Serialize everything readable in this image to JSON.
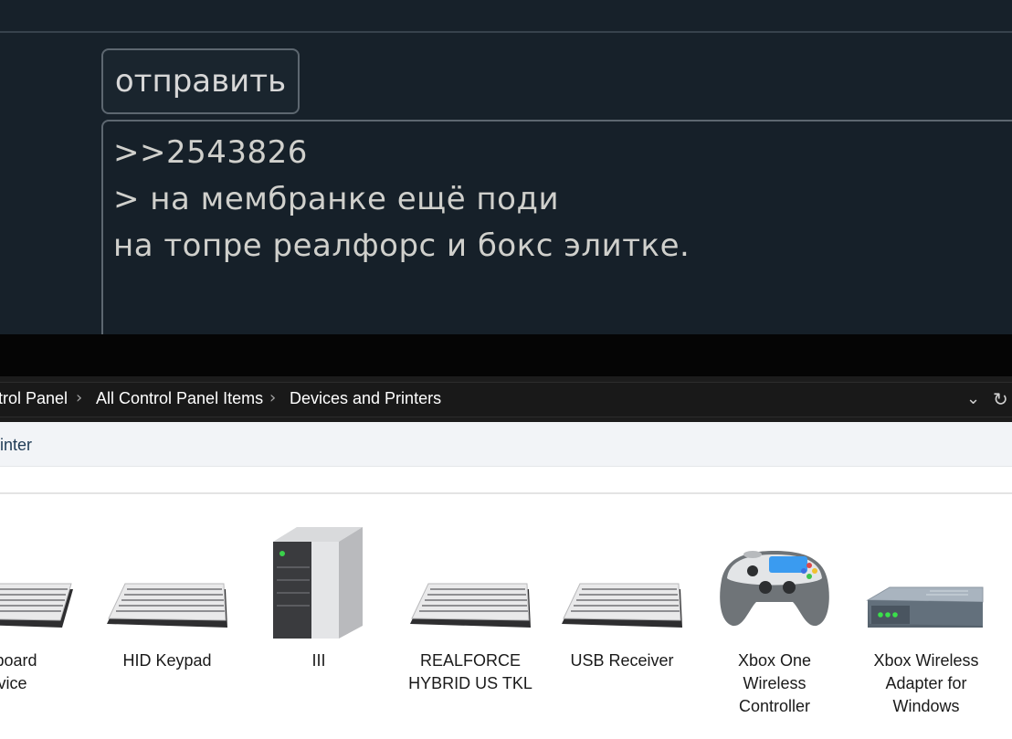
{
  "forum": {
    "send_button": "отправить",
    "reply_lines": [
      ">>2543826",
      "> на мембранке ещё поди",
      "на топре реалфорс и бокс элитке."
    ]
  },
  "explorer": {
    "breadcrumb": [
      "trol Panel",
      "All Control Panel Items",
      "Devices and Printers"
    ],
    "command_bar": {
      "partial_item": "inter"
    },
    "devices": [
      {
        "icon": "keyboard-icon",
        "lines": [
          "Keyboard",
          "Device"
        ]
      },
      {
        "icon": "keyboard-icon",
        "lines": [
          "HID Keypad"
        ]
      },
      {
        "icon": "computer-tower-icon",
        "lines": [
          "III"
        ]
      },
      {
        "icon": "keyboard-icon",
        "lines": [
          "REALFORCE",
          "HYBRID US TKL"
        ]
      },
      {
        "icon": "keyboard-icon",
        "lines": [
          "USB Receiver"
        ]
      },
      {
        "icon": "gamepad-icon",
        "lines": [
          "Xbox One",
          "Wireless",
          "Controller"
        ]
      },
      {
        "icon": "wireless-adapter-icon",
        "lines": [
          "Xbox Wireless",
          "Adapter for",
          "Windows"
        ]
      }
    ]
  },
  "colors": {
    "forum_bg": "#17212a",
    "forum_text": "#d0d0cc",
    "address_bar_bg": "#191919",
    "command_bar_bg": "#f2f4f7"
  }
}
